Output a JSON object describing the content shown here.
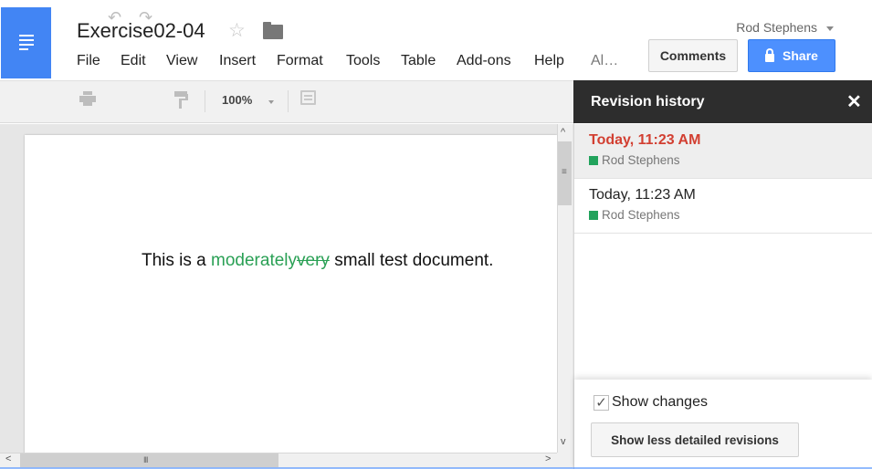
{
  "header": {
    "doc_title": "Exercise02-04",
    "user_name": "Rod Stephens",
    "comments_label": "Comments",
    "share_label": "Share"
  },
  "menu": [
    "File",
    "Edit",
    "View",
    "Insert",
    "Format",
    "Tools",
    "Table",
    "Add-ons",
    "Help",
    "Al…"
  ],
  "toolbar": {
    "zoom": "100%"
  },
  "document": {
    "text_before": "This is a ",
    "inserted": "moderately",
    "deleted": "very",
    "text_after": " small test document."
  },
  "revision_panel": {
    "title": "Revision history",
    "revisions": [
      {
        "time": "Today, 11:23 AM",
        "author": "Rod Stephens"
      },
      {
        "time": "Today, 11:23 AM",
        "author": "Rod Stephens"
      }
    ],
    "show_changes_label": "Show changes",
    "show_changes_checked": true,
    "less_detailed_label": "Show less detailed revisions"
  },
  "scrollbar": {
    "v_grip": "≡",
    "h_grip": "III"
  },
  "colors": {
    "accent_blue": "#4d90fe",
    "selected_revision_red": "#d23f31",
    "insert_green": "#2aa055",
    "author_swatch": "#22a35c"
  },
  "icons": [
    "docs-menu-icon",
    "star-icon",
    "folder-icon",
    "lock-icon",
    "print-icon",
    "undo-icon",
    "redo-icon",
    "paint-format-icon",
    "comment-icon",
    "close-icon",
    "check-icon"
  ]
}
